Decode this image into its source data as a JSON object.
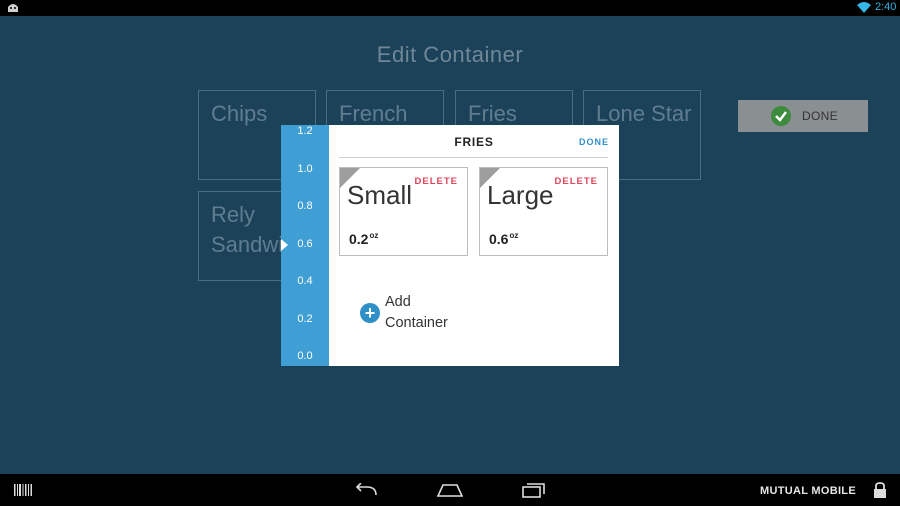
{
  "status_bar": {
    "time": "2:40",
    "wifi_icon": "wifi-icon",
    "app_icon": "android-icon"
  },
  "page": {
    "title": "Edit Container",
    "tiles": [
      {
        "label": "Chips"
      },
      {
        "label": "French"
      },
      {
        "label": "Fries"
      },
      {
        "label": "Lone Star"
      },
      {
        "label": "Rely Sandwich"
      }
    ],
    "done_button": {
      "label": "DONE",
      "icon": "check-circle-icon"
    }
  },
  "scale": {
    "ticks": [
      "1.2",
      "1.0",
      "0.8",
      "0.6",
      "0.4",
      "0.2",
      "0.0"
    ],
    "current": 0.6
  },
  "dialog": {
    "title": "FRIES",
    "done_label": "DONE",
    "containers": [
      {
        "name": "Small",
        "delete_label": "DELETE",
        "weight": "0.2",
        "unit": "oz"
      },
      {
        "name": "Large",
        "delete_label": "DELETE",
        "weight": "0.6",
        "unit": "oz"
      }
    ],
    "add_label": "Add Container"
  },
  "nav_bar": {
    "barcode_icon": "barcode-icon",
    "back_icon": "back-icon",
    "home_icon": "home-icon",
    "recents_icon": "recent-apps-icon",
    "brand": "MUTUAL MOBILE",
    "lock_icon": "lock-icon"
  },
  "colors": {
    "background": "#1c4259",
    "scale": "#3f9fd4",
    "accent": "#2f8fc7",
    "delete": "#e0445a",
    "done_check": "#3d8b3d"
  }
}
